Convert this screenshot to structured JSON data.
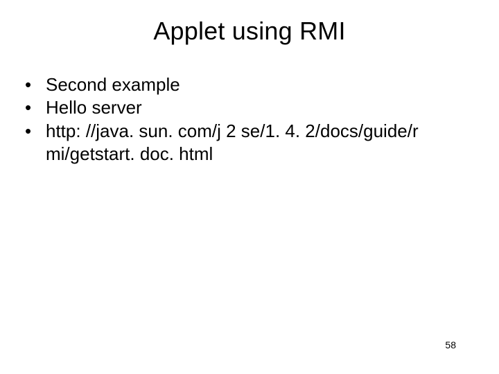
{
  "slide": {
    "title": "Applet using RMI",
    "bullets": [
      "Second example",
      "Hello server",
      "http: //java. sun. com/j 2 se/1. 4. 2/docs/guide/r mi/getstart. doc. html"
    ],
    "page_number": "58"
  }
}
